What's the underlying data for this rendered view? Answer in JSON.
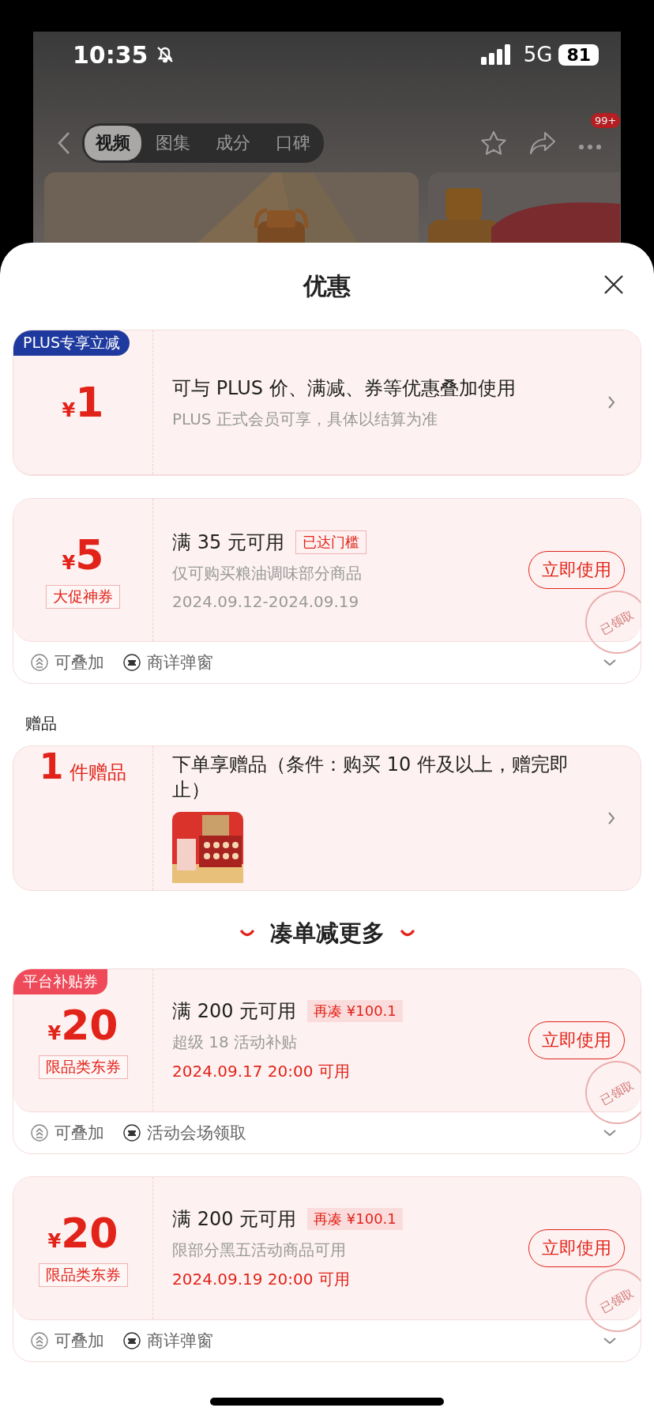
{
  "status_bar": {
    "time": "10:35",
    "network": "5G",
    "battery": "81"
  },
  "nav": {
    "tabs": [
      {
        "label": "视频",
        "selected": true
      },
      {
        "label": "图集",
        "selected": false
      },
      {
        "label": "成分",
        "selected": false
      },
      {
        "label": "口碑",
        "selected": false
      }
    ],
    "more_badge": "99+"
  },
  "sheet": {
    "title": "优惠"
  },
  "coupons": [
    {
      "kind": "plus",
      "corner_tag": {
        "text": "PLUS专享立减",
        "kind": "plus"
      },
      "currency": "¥",
      "amount": "1",
      "title": "可与 PLUS 价、满减、券等优惠叠加使用",
      "desc": "PLUS 正式会员可享，具体以结算为准"
    },
    {
      "kind": "coupon",
      "currency": "¥",
      "amount": "5",
      "amount_tag": "大促神券",
      "title": "满 35 元可用",
      "badge": {
        "text": "已达门槛",
        "kind": "outline"
      },
      "desc": "仅可购买粮油调味部分商品",
      "date": "2024.09.12-2024.09.19",
      "date_highlight": false,
      "button": "立即使用",
      "stamp": "已领取",
      "footer": [
        "可叠加",
        "商详弹窗"
      ]
    }
  ],
  "gift": {
    "heading": "赠品",
    "count": "1",
    "unit": "件赠品",
    "title": "下单享赠品（条件：购买 10 件及以上，赠完即止）"
  },
  "more_heading": "凑单减更多",
  "more_coupons": [
    {
      "kind": "coupon",
      "corner_tag": {
        "text": "平台补贴券",
        "kind": "platform"
      },
      "currency": "¥",
      "amount": "20",
      "amount_tag": "限品类东券",
      "title": "满 200 元可用",
      "badge": {
        "text": "再凑 ¥100.1",
        "kind": "filled"
      },
      "desc": "超级 18 活动补贴",
      "date": "2024.09.17 20:00 可用",
      "date_highlight": true,
      "button": "立即使用",
      "stamp": "已领取",
      "footer": [
        "可叠加",
        "活动会场领取"
      ]
    },
    {
      "kind": "coupon",
      "currency": "¥",
      "amount": "20",
      "amount_tag": "限品类东券",
      "title": "满 200 元可用",
      "badge": {
        "text": "再凑 ¥100.1",
        "kind": "filled"
      },
      "desc": "限部分黑五活动商品可用",
      "date": "2024.09.19 20:00 可用",
      "date_highlight": true,
      "button": "立即使用",
      "stamp": "已领取",
      "footer": [
        "可叠加",
        "商详弹窗"
      ]
    }
  ]
}
